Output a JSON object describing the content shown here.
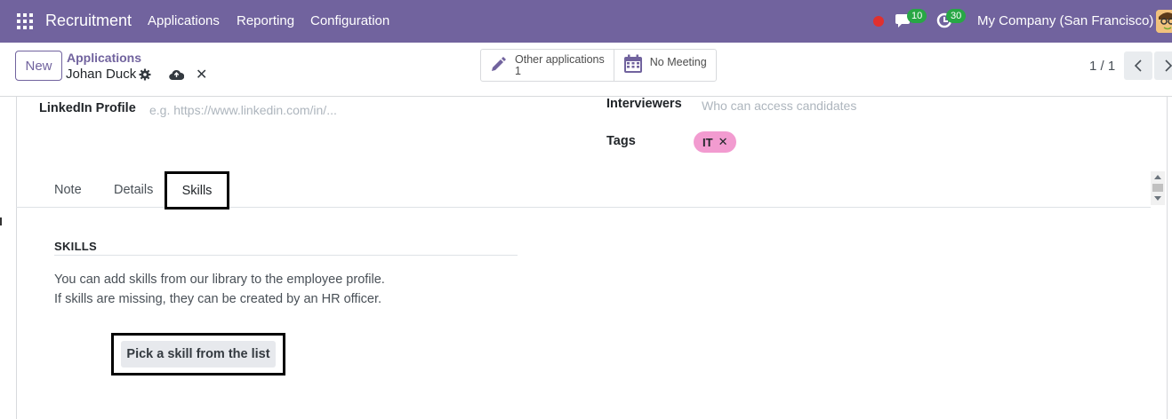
{
  "navbar": {
    "brand": "Recruitment",
    "menu": [
      "Applications",
      "Reporting",
      "Configuration"
    ],
    "messages_count": "10",
    "activities_count": "30",
    "company": "My Company (San Francisco)"
  },
  "control": {
    "new_label": "New",
    "breadcrumb_parent": "Applications",
    "breadcrumb_current": "Johan Duck",
    "smart_buttons": [
      {
        "label": "Other applications",
        "value": "1",
        "icon": "pencil-icon"
      },
      {
        "label": "No Meeting",
        "icon": "calendar-icon"
      }
    ],
    "pager": "1 / 1"
  },
  "form": {
    "linkedin_label": "LinkedIn Profile",
    "linkedin_placeholder": "e.g. https://www.linkedin.com/in/...",
    "interviewers_label": "Interviewers",
    "interviewers_placeholder": "Who can access candidates",
    "tags_label": "Tags",
    "tags": [
      "IT"
    ],
    "tabs": [
      "Note",
      "Details",
      "Skills"
    ],
    "active_tab": "Skills"
  },
  "skills": {
    "title": "SKILLS",
    "help_line1": "You can add skills from our library to the employee profile.",
    "help_line2": "If skills are missing, they can be created by an HR officer.",
    "pick_button": "Pick a skill from the list"
  },
  "colors": {
    "navbar": "#71639e",
    "tag": "#f29bd0",
    "badge": "#28a745"
  }
}
